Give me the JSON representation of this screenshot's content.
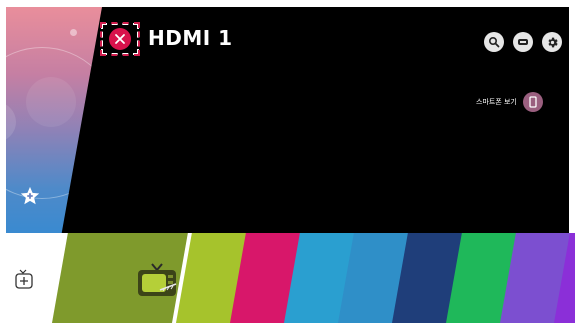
{
  "header": {
    "title": "HDMI 1"
  },
  "phone": {
    "label": "스마트폰 보기"
  },
  "icons": {
    "close": "close-icon",
    "search": "search-icon",
    "input": "input-icon",
    "settings": "gear-icon",
    "phone": "phone-icon",
    "favorite": "star-icon",
    "add": "add-input-icon",
    "tv": "tv-icon"
  },
  "colors": {
    "close": "#d8124c",
    "selected_tile": "#7f9a2c",
    "phone_button": "#9a5f7f"
  },
  "app_tiles": [
    {
      "color": "#a6c32c"
    },
    {
      "color": "#d8176a"
    },
    {
      "color": "#2a9fd0"
    },
    {
      "color": "#2f8fc8"
    },
    {
      "color": "#1f3e7a"
    },
    {
      "color": "#1fb85a"
    },
    {
      "color": "#7c4fd0"
    },
    {
      "color": "#8b2fd8"
    },
    {
      "color": "#6f5fd6"
    },
    {
      "color": "#1aa84a"
    }
  ]
}
